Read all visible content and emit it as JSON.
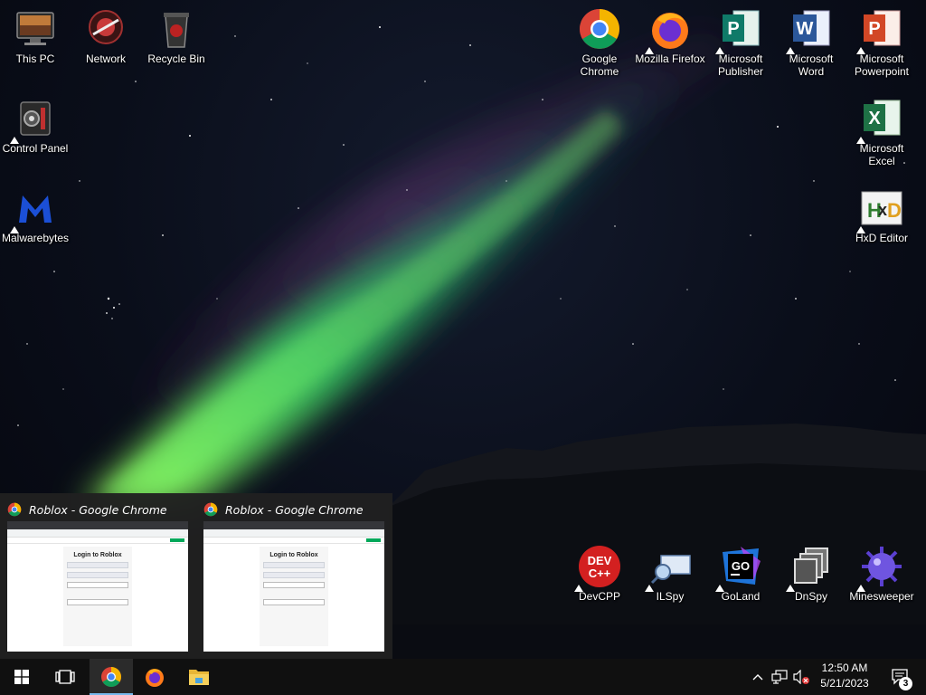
{
  "desktop": {
    "icons": [
      {
        "label": "This PC"
      },
      {
        "label": "Network"
      },
      {
        "label": "Recycle Bin"
      },
      {
        "label": "Control Panel"
      },
      {
        "label": "Malwarebytes"
      },
      {
        "label": "Google Chrome"
      },
      {
        "label": "Mozilla Firefox"
      },
      {
        "label": "Microsoft Publisher"
      },
      {
        "label": "Microsoft Word"
      },
      {
        "label": "Microsoft Powerpoint"
      },
      {
        "label": "Microsoft Excel"
      },
      {
        "label": "HxD Editor"
      },
      {
        "label": "DevCPP"
      },
      {
        "label": "ILSpy"
      },
      {
        "label": "GoLand"
      },
      {
        "label": "DnSpy"
      },
      {
        "label": "Minesweeper"
      }
    ]
  },
  "thumbnails": [
    {
      "title": "Roblox - Google Chrome",
      "page_heading": "Login to Roblox"
    },
    {
      "title": "Roblox - Google Chrome",
      "page_heading": "Login to Roblox"
    }
  ],
  "taskbar": {
    "start_icon": "windows-logo-icon",
    "items": [
      "task-view-icon",
      "chrome-icon",
      "firefox-icon",
      "file-explorer-icon"
    ],
    "tray": {
      "time": "12:50 AM",
      "date": "5/21/2023",
      "notification_count": "3"
    }
  },
  "colors": {
    "taskbar": "#101010",
    "taskbar_active": "#2b2b2b",
    "active_indicator": "#76b9ed",
    "aurora": "#3ddc6a"
  }
}
